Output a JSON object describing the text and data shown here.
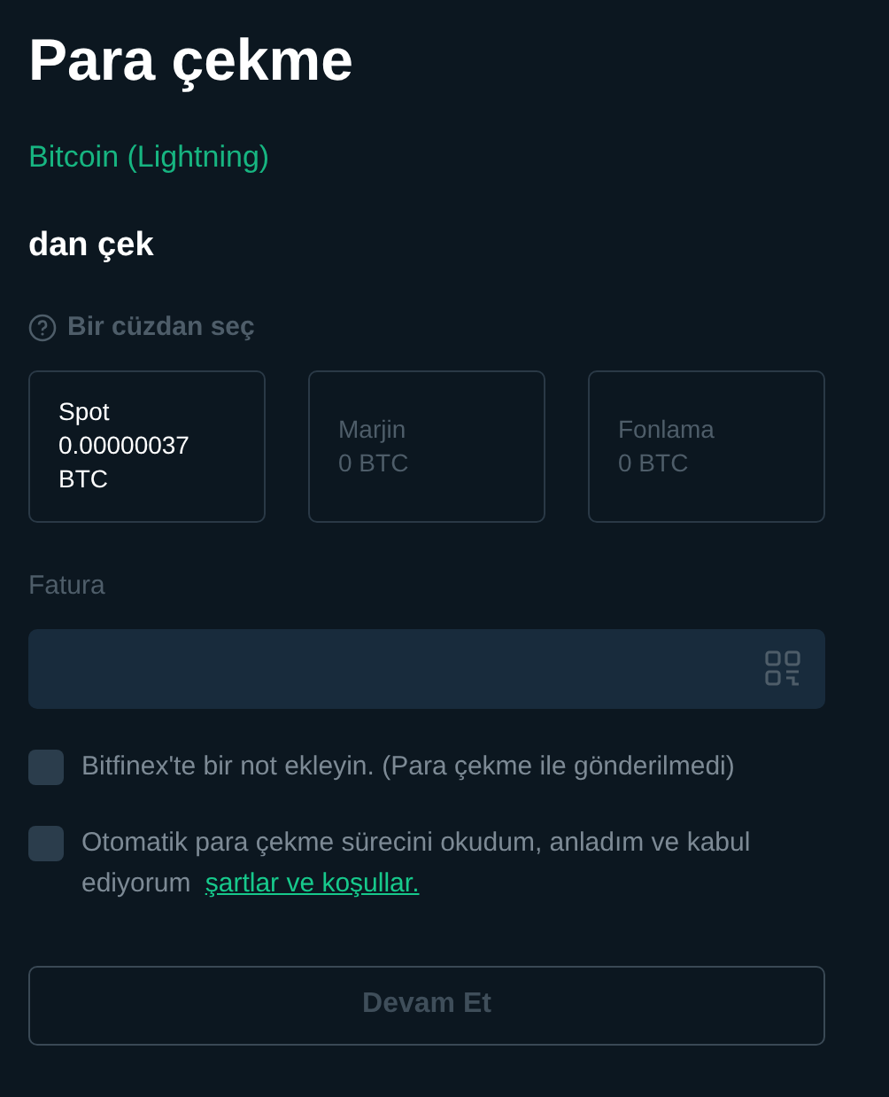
{
  "title": "Para çekme",
  "currency": "Bitcoin (Lightning)",
  "section_title": "dan çek",
  "wallet_prompt": "Bir cüzdan seç",
  "wallets": [
    {
      "name": "Spot",
      "balance": "0.00000037 BTC",
      "selected": true
    },
    {
      "name": "Marjin",
      "balance": "0 BTC",
      "selected": false
    },
    {
      "name": "Fonlama",
      "balance": "0 BTC",
      "selected": false
    }
  ],
  "invoice": {
    "label": "Fatura"
  },
  "checkboxes": [
    {
      "label": "Bitfinex'te bir not ekleyin. (Para çekme ile gönderilmedi)",
      "checked": false
    },
    {
      "label": "Otomatik para çekme sürecini okudum, anladım ve kabul ediyorum",
      "link": "şartlar ve koşullar.",
      "checked": false
    }
  ],
  "submit": {
    "label": "Devam Et",
    "disabled": true
  }
}
